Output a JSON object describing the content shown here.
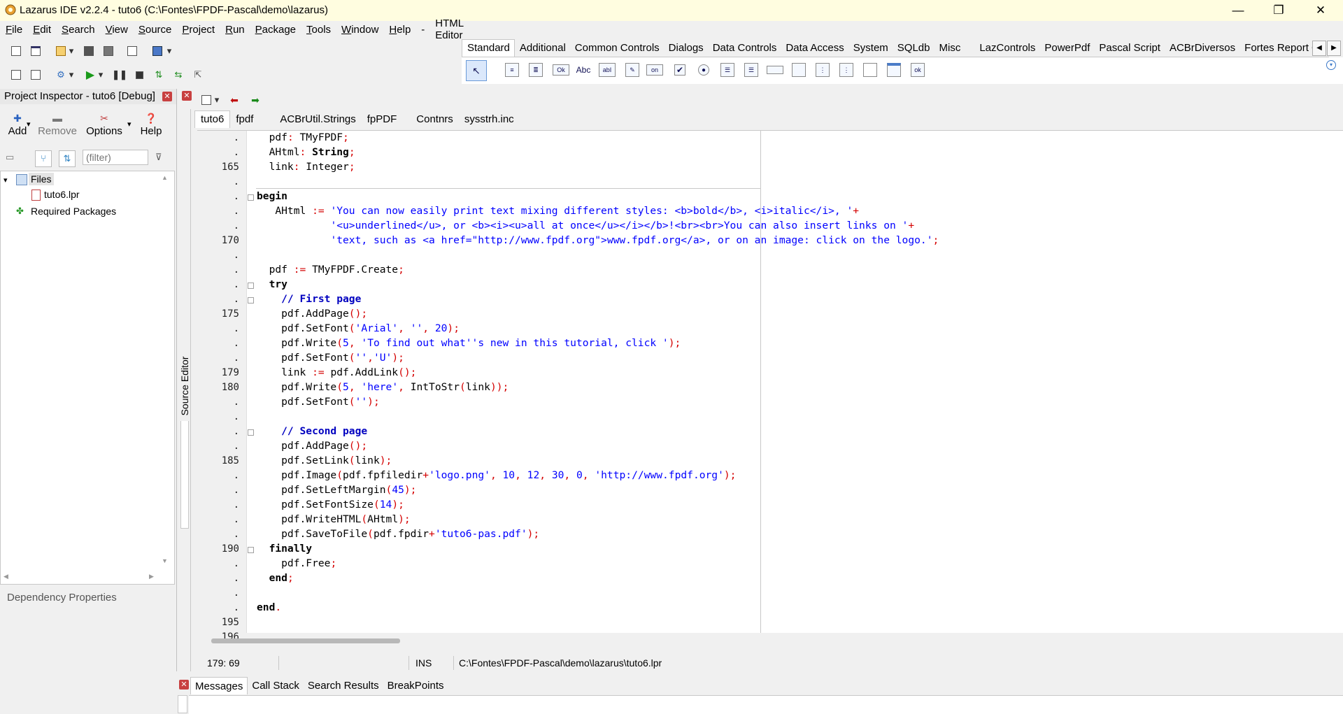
{
  "window": {
    "title": "Lazarus IDE v2.2.4 - tuto6 (C:\\Fontes\\FPDF-Pascal\\demo\\lazarus)",
    "minimize": "—",
    "restore": "❐",
    "close": "✕"
  },
  "menu": {
    "items": [
      {
        "mn": "F",
        "rest": "ile"
      },
      {
        "mn": "E",
        "rest": "dit"
      },
      {
        "mn": "S",
        "rest": "earch"
      },
      {
        "mn": "V",
        "rest": "iew"
      },
      {
        "mn": "S",
        "rest": "ource"
      },
      {
        "mn": "P",
        "rest": "roject"
      },
      {
        "mn": "R",
        "rest": "un"
      },
      {
        "mn": "P",
        "rest": "ackage"
      },
      {
        "mn": "T",
        "rest": "ools"
      },
      {
        "mn": "W",
        "rest": "indow"
      },
      {
        "mn": "H",
        "rest": "elp"
      }
    ],
    "separator": "-",
    "html_editor": "HTML Editor"
  },
  "palette": {
    "tabs": [
      "Standard",
      "Additional",
      "Common Controls",
      "Dialogs",
      "Data Controls",
      "Data Access",
      "System",
      "SQLdb",
      "Misc",
      "LazControls",
      "PowerPdf",
      "Pascal Script",
      "ACBrDiversos",
      "Fortes Report CE"
    ],
    "active_tab": "Standard",
    "icons": [
      "pointer-icon",
      "main-menu-icon",
      "popup-menu-icon",
      "button-icon",
      "label-icon",
      "edit-icon",
      "memo-icon",
      "toggle-box-icon",
      "checkbox-icon",
      "radio-button-icon",
      "listbox-icon",
      "combobox-icon",
      "scrollbar-icon",
      "groupbox-icon",
      "radiogroup-icon",
      "checkgroup-icon",
      "panel-icon",
      "frame-icon",
      "action-list-icon"
    ],
    "icon_labels": {
      "button": "Ok",
      "label": "Abc",
      "edit": "abI",
      "toggle": "on"
    }
  },
  "project_inspector": {
    "title": "Project Inspector - tuto6 [Debug]",
    "buttons": {
      "add": "Add",
      "remove": "Remove",
      "options": "Options",
      "help": "Help"
    },
    "filter_placeholder": "(filter)",
    "tree": {
      "files": "Files",
      "file1": "tuto6.lpr",
      "required": "Required Packages"
    },
    "dependency": "Dependency Properties"
  },
  "side_label": "Source Editor",
  "source_tabs": [
    "tuto6",
    "fpdf",
    "ACBrUtil.Strings",
    "fpPDF",
    "Contnrs",
    "sysstrh.inc"
  ],
  "line_numbers": [
    ".",
    ".",
    "165",
    ".",
    ".",
    ".",
    ".",
    "170",
    ".",
    ".",
    ".",
    ".",
    "175",
    ".",
    ".",
    ".",
    "179",
    "180",
    ".",
    ".",
    ".",
    ".",
    "185",
    ".",
    ".",
    ".",
    ".",
    ".",
    "190",
    ".",
    ".",
    ".",
    ".",
    "195",
    "196"
  ],
  "status": {
    "position": "179: 69",
    "mode": "INS",
    "path": "C:\\Fontes\\FPDF-Pascal\\demo\\lazarus\\tuto6.lpr"
  },
  "messages_tabs": [
    "Messages",
    "Call Stack",
    "Search Results",
    "BreakPoints"
  ]
}
